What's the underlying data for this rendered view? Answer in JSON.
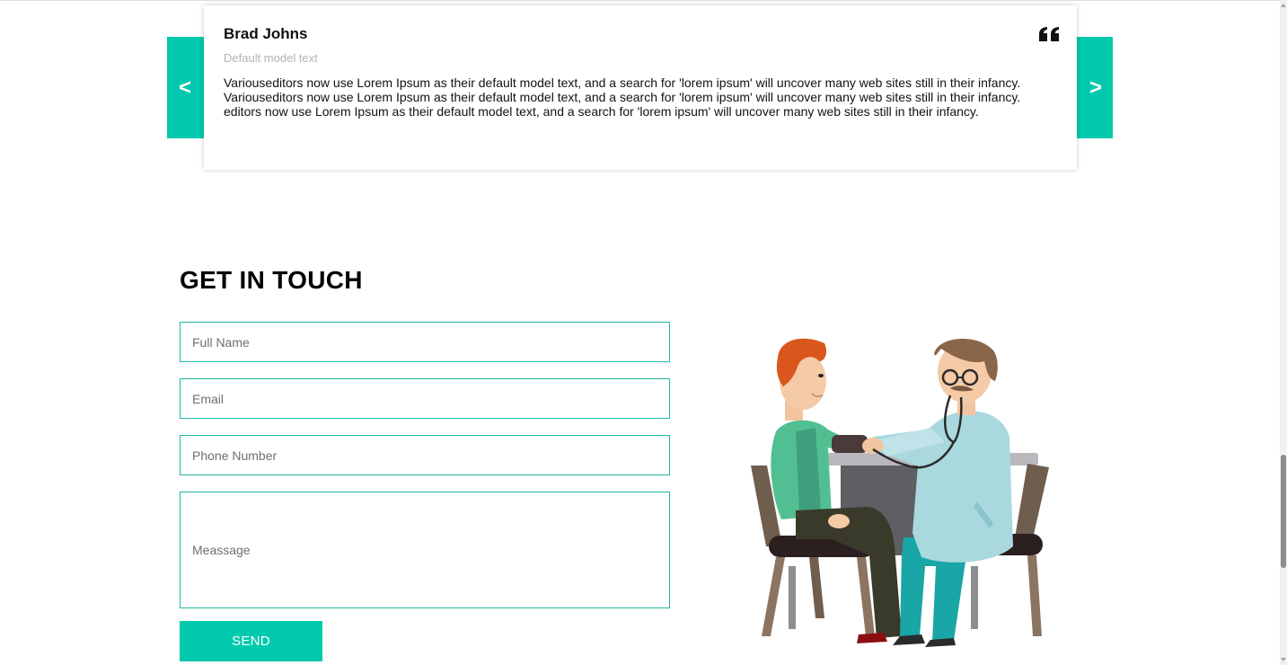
{
  "testimonial": {
    "prev_label": "<",
    "next_label": ">",
    "author_name": "Brad Johns",
    "author_role": "Default model text",
    "text": "Variouseditors now use Lorem Ipsum as their default model text, and a search for 'lorem ipsum' will uncover many web sites still in their infancy. Variouseditors now use Lorem Ipsum as their default model text, and a search for 'lorem ipsum' will uncover many web sites still in their infancy. editors now use Lorem Ipsum as their default model text, and a search for 'lorem ipsum' will uncover many web sites still in their infancy.",
    "quote_icon": "quote-icon"
  },
  "contact": {
    "title": "GET IN TOUCH",
    "full_name_placeholder": "Full Name",
    "email_placeholder": "Email",
    "phone_placeholder": "Phone Number",
    "message_placeholder": "Meassage",
    "send_label": "SEND",
    "illustration": "doctor-patient-illustration"
  },
  "colors": {
    "accent": "#00c9ad",
    "input_border": "#21b9a0",
    "muted_text": "#b3b3b3"
  }
}
